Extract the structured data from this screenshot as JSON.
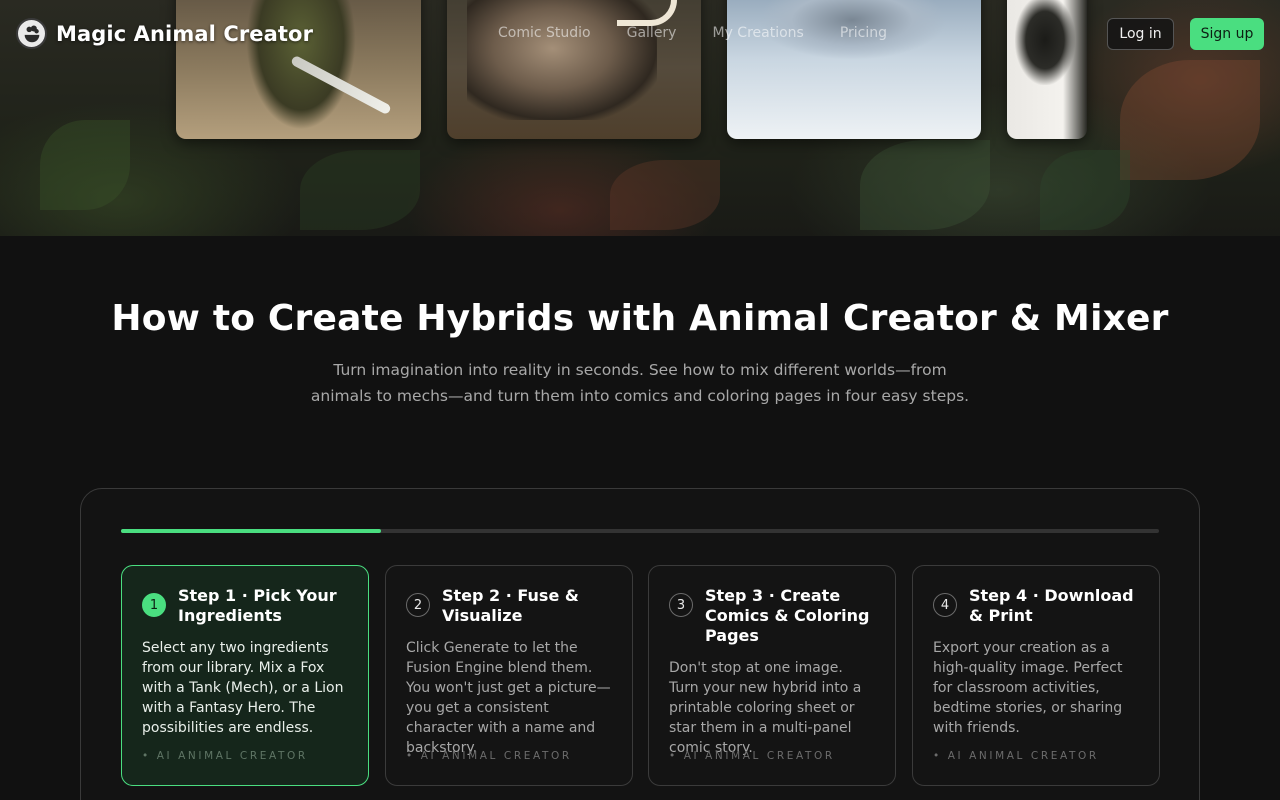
{
  "brand": {
    "name": "Magic Animal Creator",
    "logo_icon": "chef-hat-bowl-icon"
  },
  "nav": {
    "links": [
      "Comic Studio",
      "Gallery",
      "My Creations",
      "Pricing"
    ],
    "login_label": "Log in",
    "signup_label": "Sign up"
  },
  "colors": {
    "accent": "#4ade80",
    "background": "#111111"
  },
  "section": {
    "title": "How to Create Hybrids with Animal Creator & Mixer",
    "subtitle": "Turn imagination into reality in seconds. See how to mix different worlds—from animals to mechs—and turn them into comics and coloring pages in four easy steps."
  },
  "progress": {
    "value": 0.25
  },
  "steps": [
    {
      "number": "1",
      "title": "Step 1 · Pick Your Ingredients",
      "body": "Select any two ingredients from our library. Mix a Fox with a Tank (Mech), or a Lion with a Fantasy Hero. The possibilities are endless.",
      "tag": "• AI ANIMAL CREATOR",
      "active": true
    },
    {
      "number": "2",
      "title": "Step 2 · Fuse & Visualize",
      "body": "Click Generate to let the Fusion Engine blend them. You won't just get a picture—you get a consistent character with a name and backstory.",
      "tag": "• AI ANIMAL CREATOR",
      "active": false
    },
    {
      "number": "3",
      "title": "Step 3 · Create Comics & Coloring Pages",
      "body": "Don't stop at one image. Turn your new hybrid into a printable coloring sheet or star them in a multi-panel comic story.",
      "tag": "• AI ANIMAL CREATOR",
      "active": false
    },
    {
      "number": "4",
      "title": "Step 4 · Download & Print",
      "body": "Export your creation as a high-quality image. Perfect for classroom activities, bedtime stories, or sharing with friends.",
      "tag": "• AI ANIMAL CREATOR",
      "active": false
    }
  ]
}
